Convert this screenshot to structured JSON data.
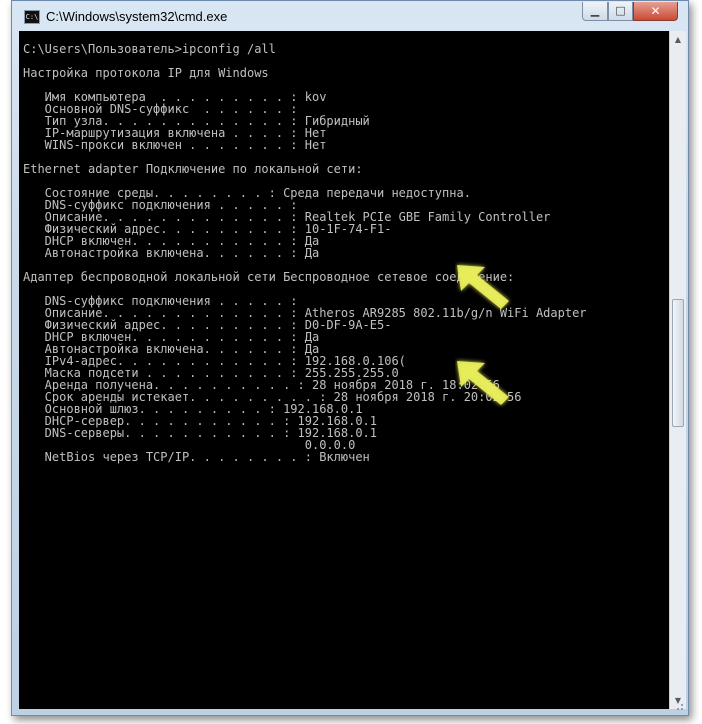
{
  "window": {
    "title": "C:\\Windows\\system32\\cmd.exe",
    "icon_name": "cmd-icon",
    "icon_glyph": "C:\\",
    "controls": {
      "minimize_glyph": "▁",
      "maximize_glyph": "□",
      "close_glyph": "✕"
    }
  },
  "console": {
    "text_color": "#c0c0c0",
    "background": "#000000",
    "lines": [
      "C:\\Users\\Пользователь>ipconfig /all",
      "",
      "Настройка протокола IP для Windows",
      "",
      "   Имя компьютера  . . . . . . . . . : kov",
      "   Основной DNS-суффикс  . . . . . . :",
      "   Тип узла. . . . . . . . . . . . . : Гибридный",
      "   IP-маршрутизация включена . . . . : Нет",
      "   WINS-прокси включен . . . . . . . : Нет",
      "",
      "Ethernet adapter Подключение по локальной сети:",
      "",
      "   Состояние среды. . . . . . . . : Среда передачи недоступна.",
      "   DNS-суффикс подключения . . . . . :",
      "   Описание. . . . . . . . . . . . . : Realtek PCIe GBE Family Controller",
      "   Физический адрес. . . . . . . . . : 10-1F-74-F1-",
      "   DHCP включен. . . . . . . . . . . : Да",
      "   Автонастройка включена. . . . . . : Да",
      "",
      "Адаптер беспроводной локальной сети Беспроводное сетевое соединение:",
      "",
      "   DNS-суффикс подключения . . . . . :",
      "   Описание. . . . . . . . . . . . . : Atheros AR9285 802.11b/g/n WiFi Adapter",
      "   Физический адрес. . . . . . . . . : D0-DF-9A-E5-",
      "   DHCP включен. . . . . . . . . . . : Да",
      "   Автонастройка включена. . . . . . : Да",
      "   IPv4-адрес. . . . . . . . . . . . : 192.168.0.106(",
      "   Маска подсети . . . . . . . . . . : 255.255.255.0",
      "   Аренда получена. . . . . . . . . . : 28 ноября 2018 г. 18:02:56",
      "   Срок аренды истекает. . . . . . . . . : 28 ноября 2018 г. 20:02:56",
      "   Основной шлюз. . . . . . . . . : 192.168.0.1",
      "   DHCP-сервер. . . . . . . . . . . : 192.168.0.1",
      "   DNS-серверы. . . . . . . . . . . : 192.168.0.1",
      "                                       0.0.0.0",
      "   NetBios через TCP/IP. . . . . . . . : Включен"
    ]
  },
  "scrollbar": {
    "up_glyph": "▲",
    "down_glyph": "▼"
  },
  "annotations": {
    "arrow_color": "#e8ee5a",
    "arrow_name": "pointer-arrow-icon"
  }
}
